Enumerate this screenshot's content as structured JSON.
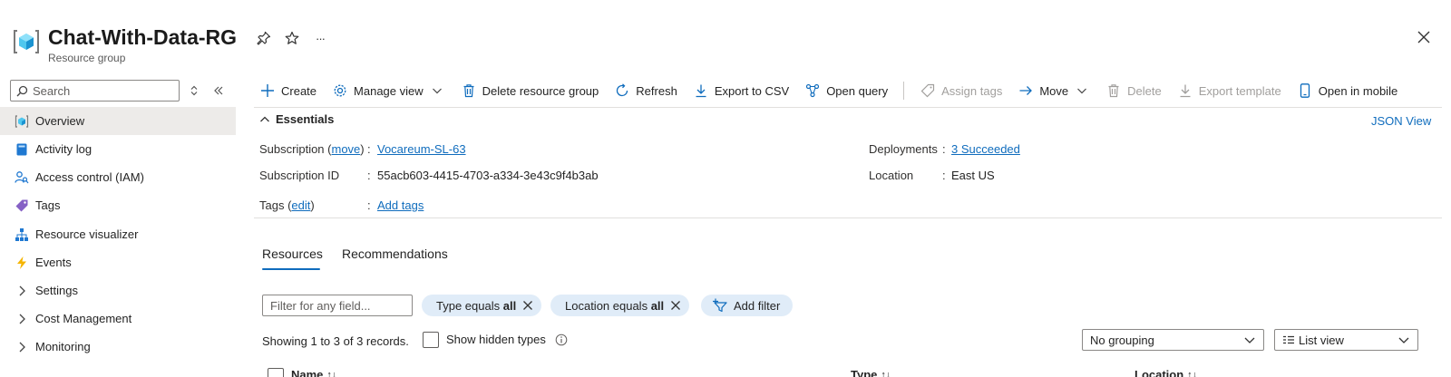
{
  "header": {
    "title": "Chat-With-Data-RG",
    "subtitle": "Resource group",
    "more_label": "···"
  },
  "sidebar": {
    "search_placeholder": "Search",
    "items": [
      {
        "label": "Overview",
        "icon": "resource-group-icon"
      },
      {
        "label": "Activity log",
        "icon": "activity-log-icon"
      },
      {
        "label": "Access control (IAM)",
        "icon": "people-icon"
      },
      {
        "label": "Tags",
        "icon": "tag-icon"
      },
      {
        "label": "Resource visualizer",
        "icon": "hierarchy-icon"
      },
      {
        "label": "Events",
        "icon": "lightning-icon"
      },
      {
        "label": "Settings",
        "icon": "chevron-right-icon"
      },
      {
        "label": "Cost Management",
        "icon": "chevron-right-icon"
      },
      {
        "label": "Monitoring",
        "icon": "chevron-right-icon"
      }
    ]
  },
  "toolbar": {
    "create": "Create",
    "manage_view": "Manage view",
    "delete_rg": "Delete resource group",
    "refresh": "Refresh",
    "export_csv": "Export to CSV",
    "open_query": "Open query",
    "assign_tags": "Assign tags",
    "move": "Move",
    "delete": "Delete",
    "export_template": "Export template",
    "open_mobile": "Open in mobile"
  },
  "essentials": {
    "heading": "Essentials",
    "json_view": "JSON View",
    "subscription_label": "Subscription",
    "move_link": "move",
    "subscription_value": "Vocareum-SL-63",
    "subscription_id_label": "Subscription ID",
    "subscription_id_value": "55acb603-4415-4703-a334-3e43c9f4b3ab",
    "tags_label": "Tags",
    "edit_link": "edit",
    "tags_value": "Add tags",
    "deployments_label": "Deployments",
    "deployments_value": "3 Succeeded",
    "location_label": "Location",
    "location_value": "East US",
    "colon": ":"
  },
  "tabs": [
    {
      "label": "Resources",
      "active": true
    },
    {
      "label": "Recommendations",
      "active": false
    }
  ],
  "filters": {
    "placeholder": "Filter for any field...",
    "type_prefix": "Type equals",
    "type_value": "all",
    "location_prefix": "Location equals",
    "location_value": "all",
    "add_filter": "Add filter"
  },
  "records": {
    "summary": "Showing 1 to 3 of 3 records.",
    "show_hidden": "Show hidden types",
    "grouping": "No grouping",
    "view": "List view"
  },
  "table": {
    "columns": [
      "Name",
      "Type",
      "Location"
    ],
    "sort_glyph": "↑↓"
  },
  "colors": {
    "accent": "#0f6cbd",
    "pill_bg": "#e0ecf8",
    "active_bg": "#edebe9"
  }
}
